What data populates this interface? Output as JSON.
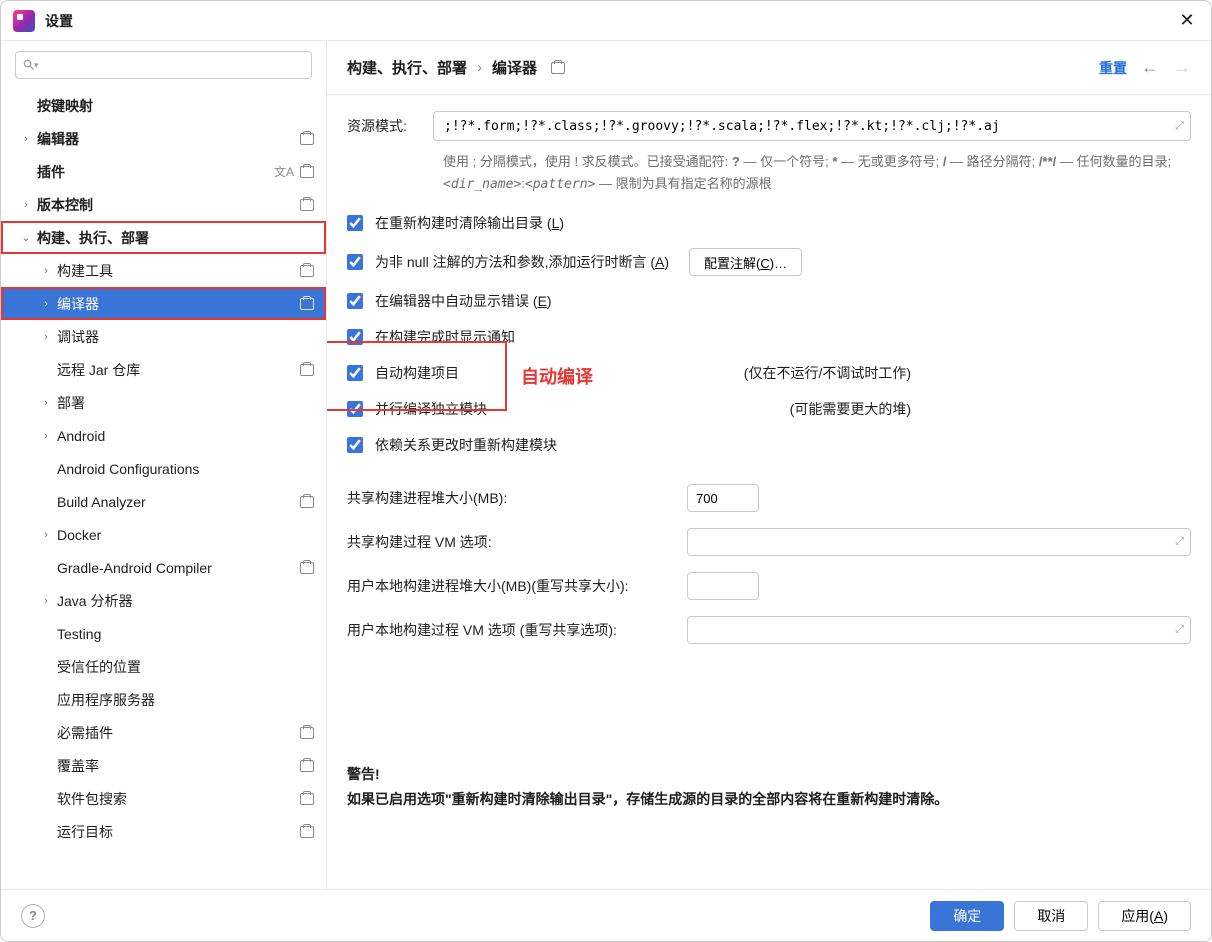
{
  "window": {
    "title": "设置"
  },
  "sidebar": {
    "items": [
      {
        "label": "按键映射",
        "bold": true,
        "indent": 0,
        "chev": ""
      },
      {
        "label": "编辑器",
        "bold": true,
        "indent": 0,
        "chev": "›",
        "badge": true
      },
      {
        "label": "插件",
        "bold": true,
        "indent": 0,
        "chev": "",
        "lang": true,
        "badge": true
      },
      {
        "label": "版本控制",
        "bold": true,
        "indent": 0,
        "chev": "›",
        "badge": true
      },
      {
        "label": "构建、执行、部署",
        "bold": true,
        "indent": 0,
        "chev": "⌄",
        "highlight": true
      },
      {
        "label": "构建工具",
        "indent": 1,
        "chev": "›",
        "badge": true
      },
      {
        "label": "编译器",
        "indent": 1,
        "chev": "›",
        "badge": true,
        "selected": true,
        "highlight": true
      },
      {
        "label": "调试器",
        "indent": 1,
        "chev": "›"
      },
      {
        "label": "远程 Jar 仓库",
        "indent": 1,
        "chev": "",
        "badge": true
      },
      {
        "label": "部署",
        "indent": 1,
        "chev": "›"
      },
      {
        "label": "Android",
        "indent": 1,
        "chev": "›"
      },
      {
        "label": "Android Configurations",
        "indent": 1,
        "chev": ""
      },
      {
        "label": "Build Analyzer",
        "indent": 1,
        "chev": "",
        "badge": true
      },
      {
        "label": "Docker",
        "indent": 1,
        "chev": "›"
      },
      {
        "label": "Gradle-Android Compiler",
        "indent": 1,
        "chev": "",
        "badge": true
      },
      {
        "label": "Java 分析器",
        "indent": 1,
        "chev": "›"
      },
      {
        "label": "Testing",
        "indent": 1,
        "chev": ""
      },
      {
        "label": "受信任的位置",
        "indent": 1,
        "chev": ""
      },
      {
        "label": "应用程序服务器",
        "indent": 1,
        "chev": ""
      },
      {
        "label": "必需插件",
        "indent": 1,
        "chev": "",
        "badge": true
      },
      {
        "label": "覆盖率",
        "indent": 1,
        "chev": "",
        "badge": true
      },
      {
        "label": "软件包搜索",
        "indent": 1,
        "chev": "",
        "badge": true
      },
      {
        "label": "运行目标",
        "indent": 1,
        "chev": "",
        "badge": true
      }
    ]
  },
  "breadcrumb": {
    "part1": "构建、执行、部署",
    "sep": "›",
    "part2": "编译器"
  },
  "header": {
    "reset": "重置"
  },
  "form": {
    "resource_pattern_label": "资源模式:",
    "resource_pattern_value": ";!?*.form;!?*.class;!?*.groovy;!?*.scala;!?*.flex;!?*.kt;!?*.clj;!?*.aj",
    "resource_help_prefix": "使用 ; 分隔模式，使用 ! 求反模式。已接受通配符: ",
    "resource_help_q": "?",
    "resource_help_q_desc": " — 仅一个符号;  ",
    "resource_help_star": "*",
    "resource_help_star_desc": " — 无或更多符号;  ",
    "resource_help_slash": "/",
    "resource_help_slash_desc": " — 路径分隔符;  ",
    "resource_help_dslash": "/**/",
    "resource_help_dslash_desc": " — 任何数量的目录;  ",
    "resource_help_dir": "<dir_name>",
    "resource_help_colon": ":",
    "resource_help_pat": "<pattern>",
    "resource_help_suffix": " — 限制为具有指定名称的源根",
    "cb_clear_output": "在重新构建时清除输出目录 (",
    "cb_clear_output_u": "L",
    "cb_clear_output_end": ")",
    "cb_null_assert": "为非 null 注解的方法和参数,添加运行时断言 (",
    "cb_null_assert_u": "A",
    "cb_null_assert_end": ")",
    "btn_configure_annotations": "配置注解(",
    "btn_configure_u": "C",
    "btn_configure_end": ")…",
    "cb_auto_show_errors": "在编辑器中自动显示错误 (",
    "cb_auto_show_errors_u": "E",
    "cb_auto_show_errors_end": ")",
    "cb_show_notification": "在构建完成时显示通知",
    "cb_auto_build": "自动构建项目",
    "cb_auto_build_note": "(仅在不运行/不调试时工作)",
    "cb_parallel": "并行编译独立模块",
    "cb_parallel_note": "(可能需要更大的堆)",
    "cb_rebuild_deps": "依赖关系更改时重新构建模块",
    "heap_size_label": "共享构建进程堆大小(MB):",
    "heap_size_value": "700",
    "vm_options_label": "共享构建过程 VM 选项:",
    "user_heap_label": "用户本地构建进程堆大小(MB)(重写共享大小):",
    "user_vm_label": "用户本地构建过程 VM 选项 (重写共享选项):",
    "annotation_text": "自动编译"
  },
  "warning": {
    "title": "警告!",
    "body": "如果已启用选项\"重新构建时清除输出目录\"，存储生成源的目录的全部内容将在重新构建时清除。"
  },
  "footer": {
    "ok": "确定",
    "cancel": "取消",
    "apply_pre": "应用(",
    "apply_u": "A",
    "apply_end": ")"
  }
}
